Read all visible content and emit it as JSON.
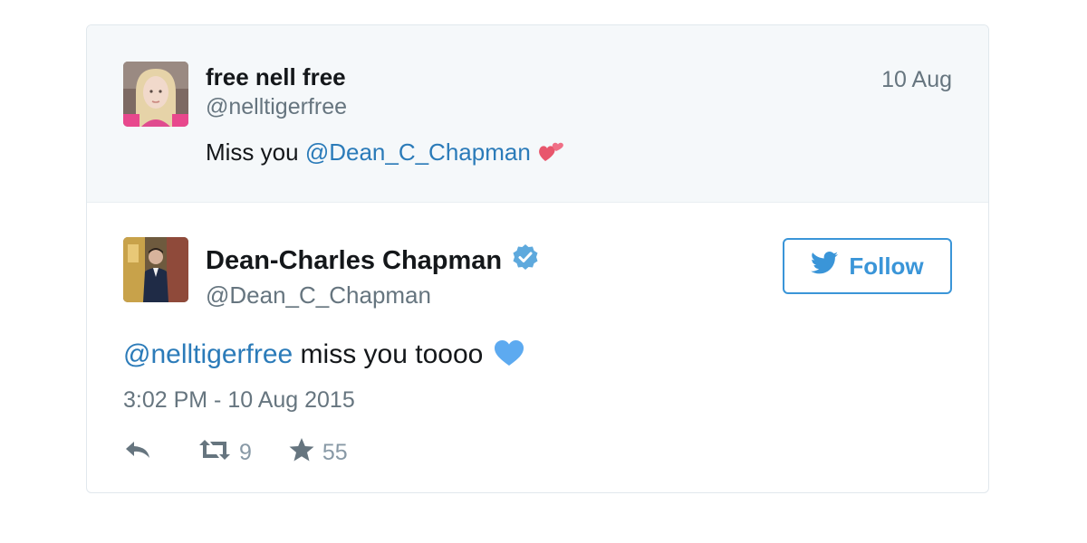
{
  "quoted_tweet": {
    "display_name": "free nell free",
    "handle": "@nelltigerfree",
    "date": "10 Aug",
    "text_prefix": "Miss you ",
    "mention": "@Dean_C_Chapman",
    "avatar_icon": "profile-photo-blonde",
    "emoji_icon": "two-hearts-icon"
  },
  "main_tweet": {
    "display_name": "Dean-Charles Chapman",
    "verified_icon": "verified-badge-icon",
    "handle": "@Dean_C_Chapman",
    "follow_label": "Follow",
    "mention": "@nelltigerfree",
    "text_suffix": " miss you toooo",
    "emoji_icon": "blue-heart-icon",
    "timestamp": "3:02 PM - 10 Aug 2015",
    "avatar_icon": "profile-photo-suit"
  },
  "actions": {
    "retweet_count": "9",
    "like_count": "55"
  },
  "colors": {
    "accent": "#3a95d8",
    "mention": "#2b7bb9",
    "muted": "#66757f",
    "quoted_bg": "#f5f8fa",
    "heart_pink": "#e8566c",
    "heart_blue": "#5daaf0"
  }
}
